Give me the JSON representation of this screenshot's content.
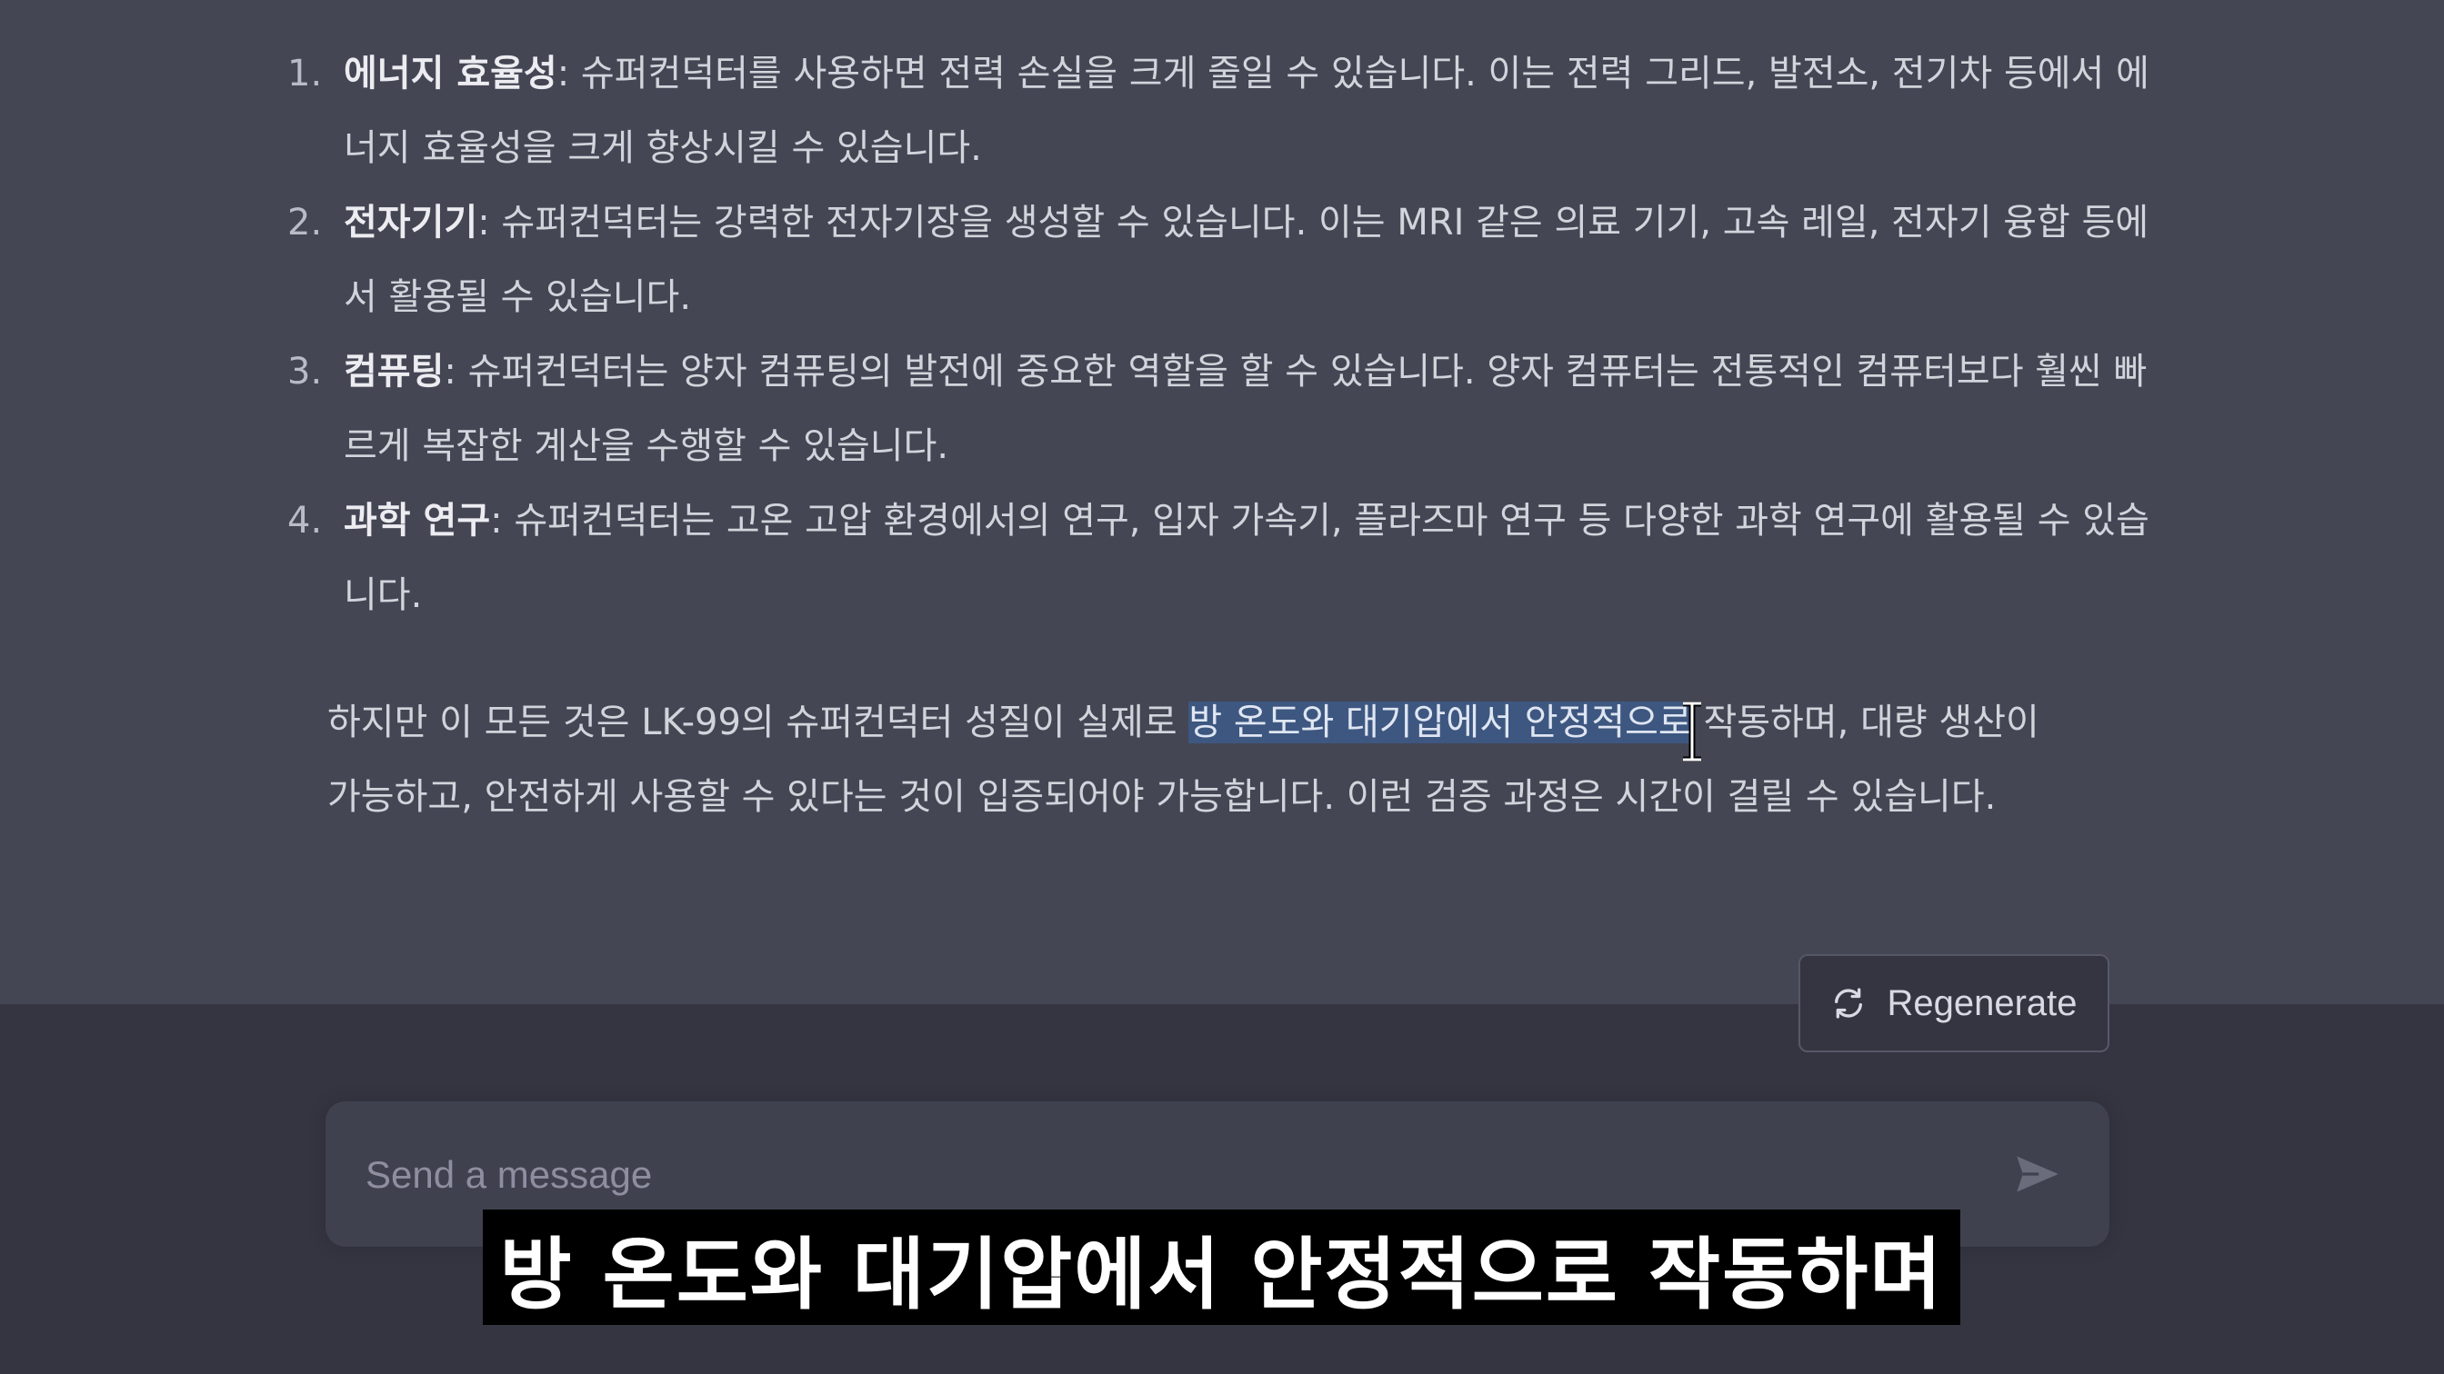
{
  "chat": {
    "items": [
      {
        "num": "1.",
        "title": "에너지 효율성",
        "text": ": 슈퍼컨덕터를 사용하면 전력 손실을 크게 줄일 수 있습니다. 이는 전력 그리드, 발전소, 전기차 등에서 에너지 효율성을 크게 향상시킬 수 있습니다."
      },
      {
        "num": "2.",
        "title": "전자기기",
        "text": ": 슈퍼컨덕터는 강력한 전자기장을 생성할 수 있습니다. 이는 MRI 같은 의료 기기, 고속 레일, 전자기 융합 등에서 활용될 수 있습니다."
      },
      {
        "num": "3.",
        "title": "컴퓨팅",
        "text": ": 슈퍼컨덕터는 양자 컴퓨팅의 발전에 중요한 역할을 할 수 있습니다. 양자 컴퓨터는 전통적인 컴퓨터보다 훨씬 빠르게 복잡한 계산을 수행할 수 있습니다."
      },
      {
        "num": "4.",
        "title": "과학 연구",
        "text": ": 슈퍼컨덕터는 고온 고압 환경에서의 연구, 입자 가속기, 플라즈마 연구 등 다양한 과학 연구에 활용될 수 있습니다."
      }
    ],
    "paragraph": {
      "before": "하지만 이 모든 것은 LK-99의 슈퍼컨덕터 성질이 실제로 ",
      "highlighted": "방 온도와 대기압에서 안정적으로",
      "after": " 작동하며, 대량 생산이 가능하고, 안전하게 사용할 수 있다는 것이 입증되어야 가능합니다. 이런 검증 과정은 시간이 걸릴 수 있습니다."
    }
  },
  "regenerate": {
    "label": "Regenerate",
    "icon": "refresh-icon"
  },
  "composer": {
    "placeholder": "Send a message",
    "send_icon": "send-icon"
  },
  "subtitle": {
    "text": "방 온도와 대기압에서 안정적으로 작동하며"
  },
  "colors": {
    "chat_bg": "#444654",
    "page_bg": "#343541",
    "input_bg": "#40414f",
    "highlight": "#3d5780",
    "text": "#d1d5db"
  }
}
